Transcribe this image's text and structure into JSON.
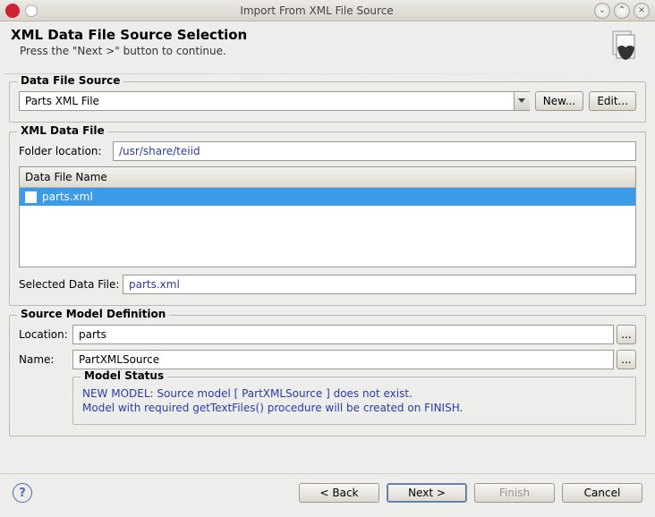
{
  "window": {
    "title": "Import From XML File Source"
  },
  "header": {
    "title": "XML Data File Source Selection",
    "subtitle": "Press the \"Next >\" button to continue."
  },
  "data_file_source": {
    "group_label": "Data File Source",
    "selected": "Parts XML File",
    "new_button": "New...",
    "edit_button": "Edit..."
  },
  "xml_data_file": {
    "group_label": "XML Data File",
    "folder_label": "Folder location:",
    "folder_value": "/usr/share/teiid",
    "column_header": "Data File Name",
    "files": [
      {
        "name": "parts.xml",
        "checked": true,
        "selected": true
      }
    ],
    "selected_label": "Selected Data File:",
    "selected_value": "parts.xml"
  },
  "source_model": {
    "group_label": "Source Model Definition",
    "location_label": "Location:",
    "location_value": "parts",
    "name_label": "Name:",
    "name_value": "PartXMLSource",
    "status_label": "Model Status",
    "status_line1": "NEW MODEL: Source model [ PartXMLSource ] does not exist.",
    "status_line2": "Model with required getTextFiles() procedure will be created on FINISH."
  },
  "footer": {
    "back": "< Back",
    "next": "Next >",
    "finish": "Finish",
    "cancel": "Cancel"
  }
}
